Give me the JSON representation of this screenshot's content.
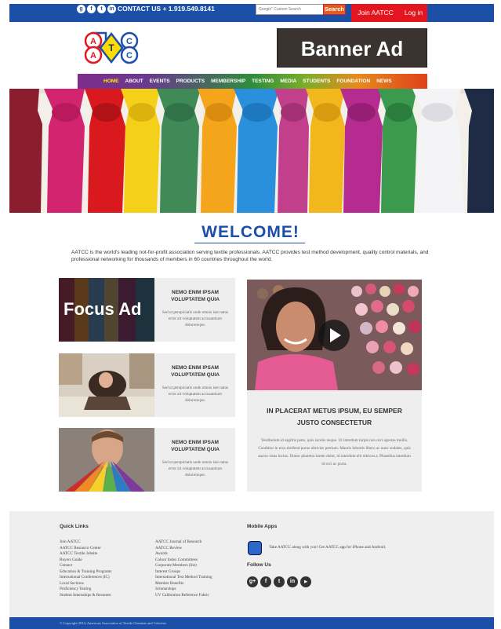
{
  "topbar": {
    "social_icons": [
      "googleplus-icon",
      "facebook-icon",
      "twitter-icon",
      "linkedin-icon"
    ],
    "contact": "CONTACT US + 1.919.549.8141",
    "search_placeholder": "Google\" Custom Search",
    "search_label": "Search",
    "join_label": "Join AATCC",
    "login_label": "Log in"
  },
  "header": {
    "banner_text": "Banner Ad"
  },
  "nav": {
    "items": [
      "HOME",
      "ABOUT",
      "EVENTS",
      "PRODUCTS",
      "MEMBERSHIP",
      "TESTING",
      "MEDIA",
      "STUDENTS",
      "FOUNDATION",
      "NEWS"
    ],
    "active": "HOME"
  },
  "welcome": {
    "title": "WELCOME!",
    "intro": "AATCC is the world's leading not-for-profit association serving textile professionals. AATCC provides test method development, quality control materials, and professional networking for thousands of members in 60 countries throughout the world."
  },
  "cards": [
    {
      "title": "NEMO ENIM IPSAM VOLUPTATEM QUIA",
      "text": "Sed ut perspiciatis unde omnis iste natus error sit voluptatem accusantium doloremque.",
      "overlay": "Focus Ad"
    },
    {
      "title": "NEMO ENIM IPSAM VOLUPTATEM QUIA",
      "text": "Sed ut perspiciatis unde omnis iste natus error sit voluptatem accusantium doloremque."
    },
    {
      "title": "NEMO ENIM IPSAM VOLUPTATEM QUIA",
      "text": "Sed ut perspiciatis unde omnis iste natus error sit voluptatem accusantium doloremque."
    }
  ],
  "feature": {
    "title": "IN PLACERAT METUS IPSUM, EU SEMPER JUSTO CONSECTETUR",
    "text": "Vestibulum id sagittis justo, quis iaculis neque. Ut interdum turpis non orci egestas mollis. Curabitur in eros eleifend purus ultricies pretium. Mauris lobortis libero ac nunc sodales, quis auctor risus luctus. Donec pharetra lorem dolor, id interdum elit ultrices a. Phasellus interdum id orci ac porta."
  },
  "footer": {
    "quick_links_title": "Quick Links",
    "links_col1": [
      "Join AATCC",
      "AATCC Resource Center",
      "AATCC Textile Jobsite",
      "Buyers Guide",
      "Contact",
      "Education & Training Programs",
      "International Conferences (IC)",
      "Local Sections",
      "Proficiency Testing",
      "Student Internships & Resumes"
    ],
    "links_col2": [
      "AATCC Journal of Research",
      "AATCC Review",
      "Awards",
      "Colour Index Committees",
      "Corporate Members (list)",
      "Interest Groups",
      "International Test Method Training",
      "Member Benefits",
      "Scholarships",
      "UV Calibration Reference Fabric"
    ],
    "mobile_title": "Mobile Apps",
    "mobile_text": "Take AATCC along with you! Get AATCC app for iPhone and Android.",
    "follow_title": "Follow Us",
    "follow_icons": [
      "googleplus-icon",
      "facebook-icon",
      "twitter-icon",
      "linkedin-icon",
      "youtube-icon"
    ],
    "copyright": "© Copyright 2014, American Association of Textile Chemists and Colorists"
  },
  "colors": {
    "brand_blue": "#1c4fa8",
    "join_red": "#e3161f",
    "search_orange": "#e55b1e"
  }
}
